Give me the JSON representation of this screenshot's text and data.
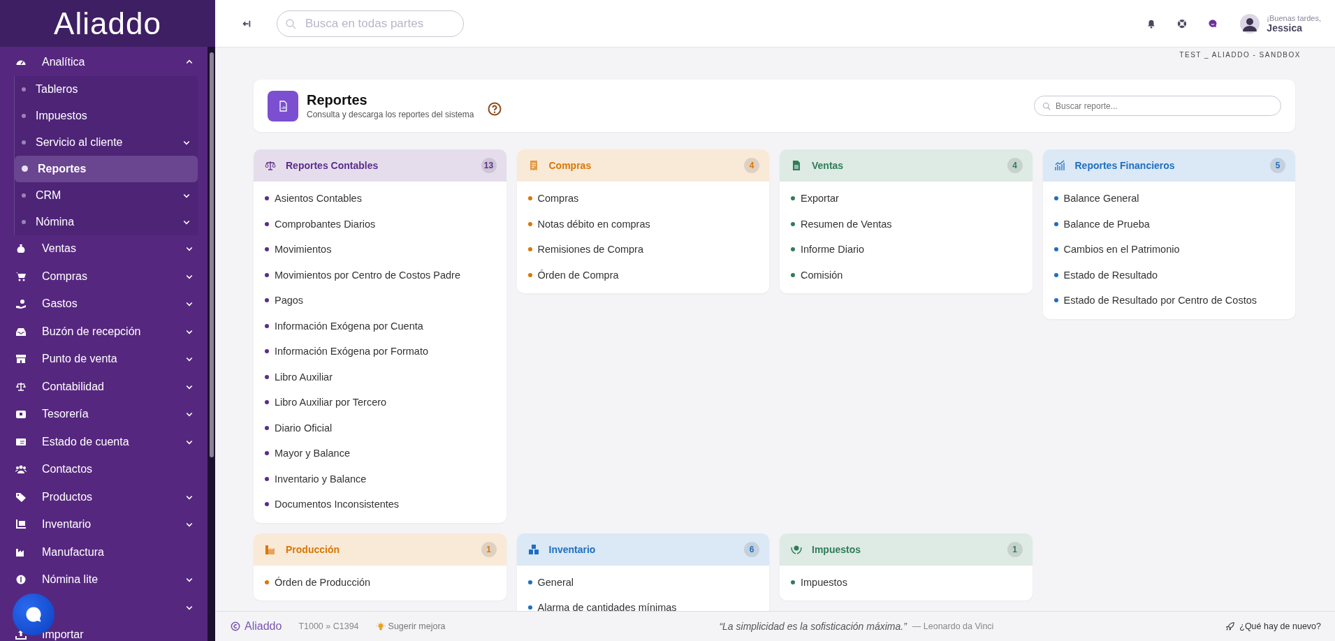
{
  "app": {
    "logo": "Aliaddo"
  },
  "sidebar": {
    "items": [
      {
        "label": "Analítica",
        "expanded": true,
        "selected": false,
        "children": [
          {
            "label": "Tableros",
            "selected": false
          },
          {
            "label": "Impuestos",
            "selected": false
          },
          {
            "label": "Servicio al cliente",
            "expanded": false,
            "selected": false
          },
          {
            "label": "Reportes",
            "selected": true
          },
          {
            "label": "CRM",
            "expanded": false,
            "selected": false
          },
          {
            "label": "Nómina",
            "expanded": false,
            "selected": false
          }
        ]
      },
      {
        "label": "Ventas",
        "expanded": false,
        "selected": false
      },
      {
        "label": "Compras",
        "expanded": false,
        "selected": false
      },
      {
        "label": "Gastos",
        "expanded": false,
        "selected": false
      },
      {
        "label": "Buzón de recepción",
        "expanded": false,
        "selected": false
      },
      {
        "label": "Punto de venta",
        "expanded": false,
        "selected": false
      },
      {
        "label": "Contabilidad",
        "expanded": false,
        "selected": false
      },
      {
        "label": "Tesorería",
        "expanded": false,
        "selected": false
      },
      {
        "label": "Estado de cuenta",
        "expanded": false,
        "selected": false
      },
      {
        "label": "Contactos",
        "selected": false
      },
      {
        "label": "Productos",
        "expanded": false,
        "selected": false
      },
      {
        "label": "Inventario",
        "expanded": false,
        "selected": false
      },
      {
        "label": "Manufactura",
        "selected": false
      },
      {
        "label": "Nómina lite",
        "expanded": false,
        "selected": false
      },
      {
        "expanded": false,
        "selected": false
      },
      {
        "label": "Importar",
        "selected": false
      }
    ]
  },
  "header": {
    "search": {
      "placeholder": "Busca en todas partes"
    },
    "greeting": "¡Buenas tardes,",
    "user": "Jessica"
  },
  "environment": "TEST _ ALIADDO - SANDBOX",
  "page": {
    "title": "Reportes",
    "subtitle": "Consulta y descarga los reportes del sistema",
    "search": {
      "placeholder": "Buscar reporte..."
    }
  },
  "report_groups": [
    {
      "title": "Reportes Contables",
      "count": "13",
      "color": "#5b2d8a",
      "items": [
        "Asientos Contables",
        "Comprobantes Diarios",
        "Movimientos",
        "Movimientos por Centro de Costos Padre",
        "Pagos",
        "Información Exógena por Cuenta",
        "Información Exógena por Formato",
        "Libro Auxiliar",
        "Libro Auxiliar por Tercero",
        "Diario Oficial",
        "Mayor y Balance",
        "Inventario y Balance",
        "Documentos Inconsistentes"
      ]
    },
    {
      "title": "Compras",
      "count": "4",
      "color": "#d97706",
      "items": [
        "Compras",
        "Notas débito en compras",
        "Remisiones de Compra",
        "Órden de Compra"
      ]
    },
    {
      "title": "Ventas",
      "count": "4",
      "color": "#2f7d57",
      "items": [
        "Exportar",
        "Resumen de Ventas",
        "Informe Diario",
        "Comisión"
      ]
    },
    {
      "title": "Reportes Financieros",
      "count": "5",
      "color": "#1e6fc0",
      "items": [
        "Balance General",
        "Balance de Prueba",
        "Cambios en el Patrimonio",
        "Estado de Resultado",
        "Estado de Resultado por Centro de Costos"
      ]
    },
    {
      "title": "Producción",
      "count": "1",
      "color": "#d97706",
      "items": [
        "Órden de Producción"
      ]
    },
    {
      "title": "Inventario",
      "count": "6",
      "color": "#1e6fc0",
      "items": [
        "General",
        "Alarma de cantidades mínimas"
      ]
    },
    {
      "title": "Impuestos",
      "count": "1",
      "color": "#2f7d57",
      "items": [
        "Impuestos"
      ]
    }
  ],
  "footer": {
    "brand": "Aliaddo",
    "version": "T1000 » C1394",
    "suggest": "Sugerir mejora",
    "quote": "“La simplicidad es la sofisticación máxima.”",
    "author": "— Leonardo da Vinci",
    "news": "¿Qué hay de nuevo?"
  }
}
